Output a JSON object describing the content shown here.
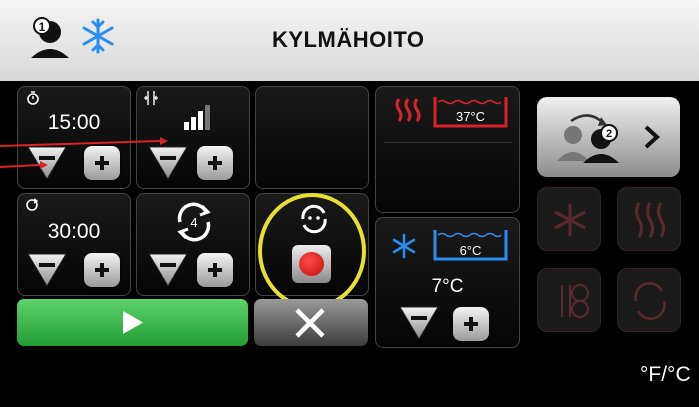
{
  "header": {
    "title": "KYLMÄHOITO",
    "user_number": "1"
  },
  "timer1": {
    "value": "15:00"
  },
  "timer2": {
    "value": "30:00"
  },
  "cycle": {
    "count": "4"
  },
  "hot_bath": {
    "temp": "37°C"
  },
  "cold_bath": {
    "temp": "6°C",
    "setpoint": "7°C"
  },
  "user_switch": {
    "user_number": "2"
  },
  "units": {
    "label": "°F/°C"
  },
  "colors": {
    "accent_red": "#d8232a",
    "accent_blue": "#2a8ef0",
    "start_green": "#2eb343",
    "highlight_yellow": "#e5e032"
  }
}
